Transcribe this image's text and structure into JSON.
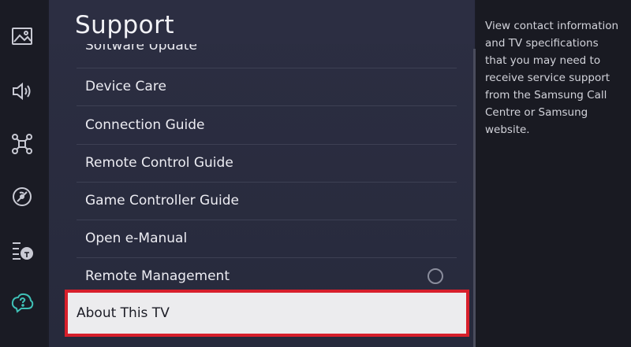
{
  "screen": {
    "title": "Support",
    "description": "View contact information and TV specifications that you may need to receive service support from the Samsung Call Centre or Samsung website."
  },
  "left_rail": {
    "icons": [
      "picture-icon",
      "sound-icon",
      "connection-icon",
      "broadcasting-icon",
      "accessibility-icon",
      "support-icon"
    ]
  },
  "menu": {
    "partial_item": "Software Update",
    "items": [
      {
        "label": "Device Care"
      },
      {
        "label": "Connection Guide"
      },
      {
        "label": "Remote Control Guide"
      },
      {
        "label": "Game Controller Guide"
      },
      {
        "label": "Open e-Manual"
      },
      {
        "label": "Remote Management"
      }
    ],
    "selected_item": "About This TV"
  },
  "colors": {
    "selection_border": "#d71f2b",
    "selection_fill": "#ececee",
    "panel": "#2c2e42",
    "background": "#1b1c26"
  }
}
